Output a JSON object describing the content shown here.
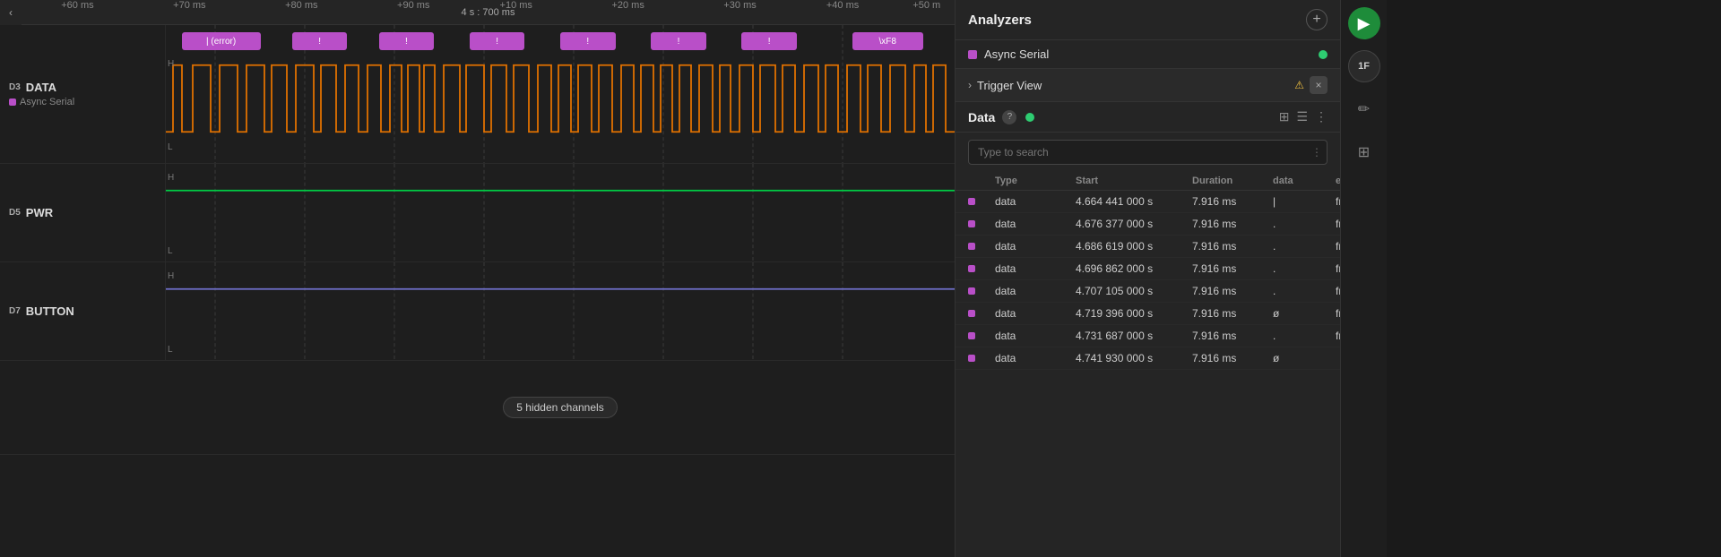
{
  "timeline": {
    "center_label": "4 s : 700 ms",
    "markers": [
      {
        "label": "+60 ms",
        "left_pct": 5
      },
      {
        "label": "+70 ms",
        "left_pct": 17
      },
      {
        "label": "+80 ms",
        "left_pct": 29
      },
      {
        "label": "+90 ms",
        "left_pct": 41
      },
      {
        "label": "+10 ms",
        "left_pct": 52
      },
      {
        "label": "+20 ms",
        "left_pct": 64
      },
      {
        "label": "+30 ms",
        "left_pct": 76
      },
      {
        "label": "+40 ms",
        "left_pct": 88
      },
      {
        "label": "+50 m",
        "left_pct": 98
      }
    ]
  },
  "channels": [
    {
      "id": "D3",
      "name": "DATA",
      "sub": "Async Serial",
      "sub_color": "#b94fc8",
      "annotations": [
        {
          "label": "| (error)",
          "left_pct": 5,
          "width_pct": 9
        },
        {
          "label": "!",
          "left_pct": 17,
          "width_pct": 7
        },
        {
          "label": "!",
          "left_pct": 28,
          "width_pct": 7
        },
        {
          "label": "!",
          "left_pct": 39,
          "width_pct": 7
        },
        {
          "label": "!",
          "left_pct": 51,
          "width_pct": 7
        },
        {
          "label": "!",
          "left_pct": 62,
          "width_pct": 7
        },
        {
          "label": "!",
          "left_pct": 73,
          "width_pct": 7
        },
        {
          "label": "\\xF8",
          "left_pct": 88,
          "width_pct": 8
        }
      ]
    },
    {
      "id": "D5",
      "name": "PWR",
      "sub": null
    },
    {
      "id": "D7",
      "name": "BUTTON",
      "sub": null
    }
  ],
  "hidden_channels": {
    "label": "5 hidden channels"
  },
  "analyzers": {
    "title": "Analyzers",
    "add_label": "+",
    "items": [
      {
        "name": "Async Serial",
        "color": "#b94fc8",
        "status": "green"
      }
    ],
    "trigger_view": {
      "label": "Trigger View",
      "has_warning": true
    }
  },
  "data_section": {
    "title": "Data",
    "search_placeholder": "Type to search",
    "columns": [
      "",
      "Type",
      "Start",
      "Duration",
      "data",
      "error"
    ],
    "rows": [
      {
        "type": "data",
        "start": "4.664 441 000 s",
        "duration": "7.916 ms",
        "data": "|",
        "error": "framing"
      },
      {
        "type": "data",
        "start": "4.676 377 000 s",
        "duration": "7.916 ms",
        "data": ".",
        "error": "framing"
      },
      {
        "type": "data",
        "start": "4.686 619 000 s",
        "duration": "7.916 ms",
        "data": ".",
        "error": "framing"
      },
      {
        "type": "data",
        "start": "4.696 862 000 s",
        "duration": "7.916 ms",
        "data": ".",
        "error": "framing"
      },
      {
        "type": "data",
        "start": "4.707 105 000 s",
        "duration": "7.916 ms",
        "data": ".",
        "error": "framing"
      },
      {
        "type": "data",
        "start": "4.719 396 000 s",
        "duration": "7.916 ms",
        "data": "ø",
        "error": "framing"
      },
      {
        "type": "data",
        "start": "4.731 687 000 s",
        "duration": "7.916 ms",
        "data": ".",
        "error": "framing"
      },
      {
        "type": "data",
        "start": "4.741 930 000 s",
        "duration": "7.916 ms",
        "data": "ø",
        "error": ""
      }
    ]
  },
  "far_right": {
    "play_label": "▶",
    "badge_label": "1F",
    "edit_label": "✏",
    "grid_label": "⊞"
  }
}
